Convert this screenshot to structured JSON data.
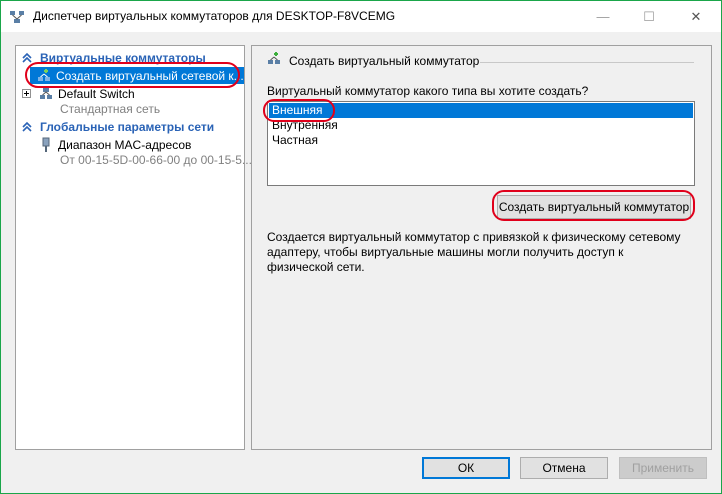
{
  "window": {
    "title": "Диспетчер виртуальных коммутаторов для DESKTOP-F8VCEMG",
    "controls": {
      "minimize": "—",
      "maximize": "☐",
      "close": "✕"
    }
  },
  "left_pane": {
    "section1": "Виртуальные коммутаторы",
    "create_item": "Создать виртуальный сетевой к...",
    "default_switch": "Default Switch",
    "default_switch_sub": "Стандартная сеть",
    "section2": "Глобальные параметры сети",
    "mac_item": "Диапазон MAC-адресов",
    "mac_sub": "От 00-15-5D-00-66-00 до 00-15-5..."
  },
  "right_pane": {
    "group_title": "Создать виртуальный коммутатор",
    "prompt": "Виртуальный коммутатор какого типа вы хотите создать?",
    "options": [
      "Внешняя",
      "Внутренняя",
      "Частная"
    ],
    "selected_option": "Внешняя",
    "create_button": "Создать виртуальный коммутатор",
    "description": "Создается виртуальный коммутатор с привязкой к физическому сетевому адаптеру, чтобы виртуальные машины могли получить доступ к физической сети."
  },
  "buttons": {
    "ok": "ОК",
    "cancel": "Отмена",
    "apply": "Применить"
  },
  "colors": {
    "selection": "#0078d7",
    "section_header": "#2a63b6",
    "annotation": "#e0001b"
  }
}
